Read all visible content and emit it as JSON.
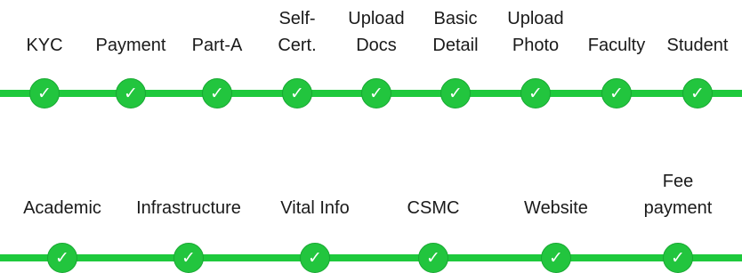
{
  "accent_color": "#22c53e",
  "check_glyph": "✓",
  "row1": {
    "steps": [
      {
        "label": "KYC",
        "status": "complete",
        "icon": "check-icon"
      },
      {
        "label": "Payment",
        "status": "complete",
        "icon": "check-icon"
      },
      {
        "label": "Part-A",
        "status": "complete",
        "icon": "check-icon"
      },
      {
        "label": "Self-\nCert.",
        "status": "complete",
        "icon": "check-icon"
      },
      {
        "label": "Upload\nDocs",
        "status": "complete",
        "icon": "check-icon"
      },
      {
        "label": "Basic\nDetail",
        "status": "complete",
        "icon": "check-icon"
      },
      {
        "label": "Upload\nPhoto",
        "status": "complete",
        "icon": "check-icon"
      },
      {
        "label": "Faculty",
        "status": "complete",
        "icon": "check-icon"
      },
      {
        "label": "Student",
        "status": "complete",
        "icon": "check-icon"
      }
    ]
  },
  "row2": {
    "steps": [
      {
        "label": "Academic",
        "status": "complete",
        "icon": "check-icon"
      },
      {
        "label": "Infrastructure",
        "status": "complete",
        "icon": "check-icon"
      },
      {
        "label": "Vital Info",
        "status": "complete",
        "icon": "check-icon"
      },
      {
        "label": "CSMC",
        "status": "complete",
        "icon": "check-icon"
      },
      {
        "label": "Website",
        "status": "complete",
        "icon": "check-icon"
      },
      {
        "label": "Fee\npayment",
        "status": "complete",
        "icon": "check-icon"
      }
    ]
  }
}
